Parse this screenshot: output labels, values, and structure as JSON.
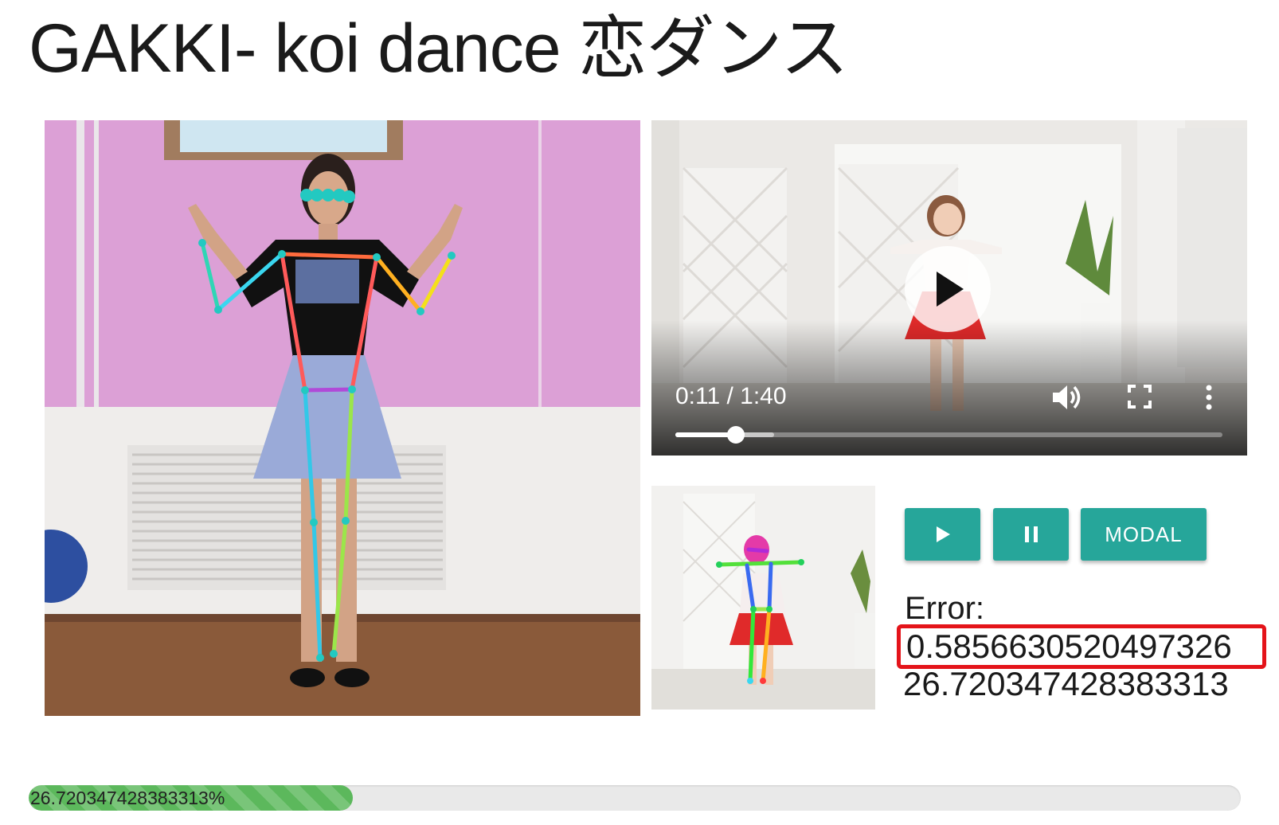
{
  "page": {
    "title": "GAKKI- koi dance 恋ダンス"
  },
  "video": {
    "time_label": "0:11 / 1:40",
    "played_fraction": 0.11,
    "buffered_fraction": 0.18,
    "play_icon": "play-icon",
    "volume_icon": "volume-icon",
    "fullscreen_icon": "fullscreen-icon",
    "more_icon": "more-vert-icon"
  },
  "controls": {
    "play_icon": "play-icon",
    "pause_icon": "pause-icon",
    "modal_label": "MODAL",
    "accent_color": "#26a69a"
  },
  "results": {
    "error_label": "Error:",
    "error_value": "0.5856630520497326",
    "score_value": "26.720347428383313",
    "highlight_color": "#e4141a"
  },
  "progress": {
    "label": "26.720347428383313%",
    "percent": 26.720347428383313,
    "color": "#5cb85c"
  }
}
